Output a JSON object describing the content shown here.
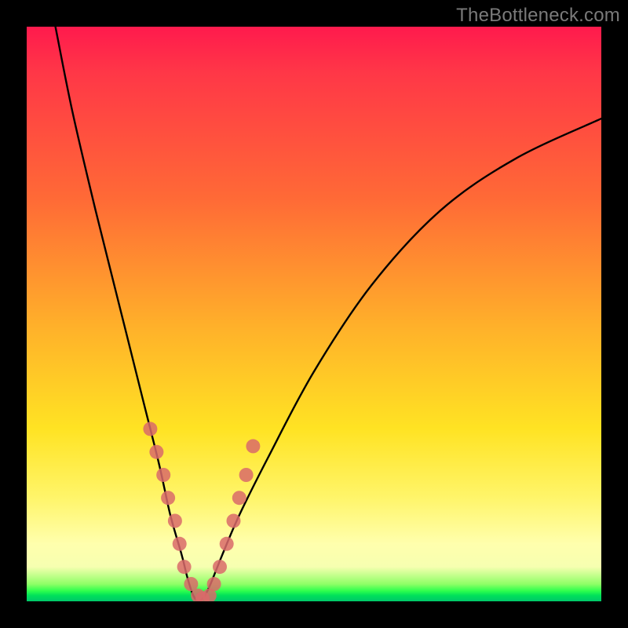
{
  "watermark": "TheBottleneck.com",
  "chart_data": {
    "type": "line",
    "title": "",
    "xlabel": "",
    "ylabel": "",
    "xlim": [
      0,
      100
    ],
    "ylim": [
      0,
      100
    ],
    "series": [
      {
        "name": "bottleneck-curve",
        "x": [
          5,
          8,
          12,
          16,
          20,
          23,
          25,
          27,
          28,
          29,
          30,
          31,
          32,
          34,
          37,
          42,
          50,
          60,
          72,
          85,
          100
        ],
        "y": [
          100,
          85,
          68,
          52,
          36,
          24,
          15,
          8,
          4,
          1,
          0,
          1,
          3,
          8,
          15,
          25,
          40,
          55,
          68,
          77,
          84
        ]
      }
    ],
    "markers": {
      "name": "highlighted-points",
      "color": "#d96a6a",
      "x": [
        21.5,
        22.6,
        23.8,
        24.6,
        25.8,
        26.6,
        27.4,
        28.6,
        29.8,
        30.6,
        31.8,
        32.6,
        33.6,
        34.8,
        36.0,
        37.0,
        38.2,
        39.4
      ],
      "y": [
        30,
        26,
        22,
        18,
        14,
        10,
        6,
        3,
        1,
        0.5,
        1,
        3,
        6,
        10,
        14,
        18,
        22,
        27
      ]
    },
    "gradient_stops": [
      {
        "pos": 0,
        "color": "#ff1a4d"
      },
      {
        "pos": 30,
        "color": "#ff6a36"
      },
      {
        "pos": 70,
        "color": "#ffe323"
      },
      {
        "pos": 94,
        "color": "#f6ffb0"
      },
      {
        "pos": 100,
        "color": "#00c86a"
      }
    ]
  }
}
